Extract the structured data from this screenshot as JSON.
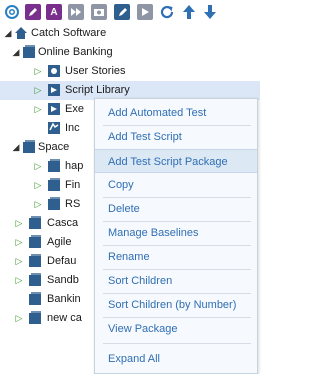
{
  "toolbar": {
    "buttons": [
      {
        "icon": "gear-icon"
      },
      {
        "icon": "edit-pencil-icon"
      },
      {
        "icon": "edit-text-icon",
        "text": "A"
      },
      {
        "icon": "execute-icon"
      },
      {
        "icon": "camera-icon"
      },
      {
        "icon": "edit-folder-icon"
      },
      {
        "icon": "run-icon"
      },
      {
        "icon": "refresh-icon"
      },
      {
        "icon": "move-up-icon"
      },
      {
        "icon": "move-down-icon"
      }
    ]
  },
  "tree": {
    "root": "Catch Software",
    "nodes": {
      "online_banking": "Online Banking",
      "user_stories": "User Stories",
      "script_library": "Script Library",
      "exe": "Exe",
      "inc": "Inc",
      "space": "Space",
      "hap": "hap",
      "fin": "Fin",
      "rs": "RS",
      "casca": "Casca",
      "agile": "Agile",
      "defau": "Defau",
      "sandb": "Sandb",
      "bankin": "Bankin",
      "new_ca": "new ca"
    }
  },
  "context_menu": {
    "items": [
      "Add Automated Test",
      "Add Test Script",
      "Add Test Script Package",
      "Copy",
      "Delete",
      "Manage Baselines",
      "Rename",
      "Sort Children",
      "Sort Children (by Number)",
      "View Package",
      "Expand All"
    ],
    "highlighted_index": 2
  },
  "colors": {
    "accent_purple": "#7a2f8e",
    "accent_blue": "#2f6fb4",
    "tree_icon": "#2f5f8f",
    "selection": "#dbe7f6"
  }
}
